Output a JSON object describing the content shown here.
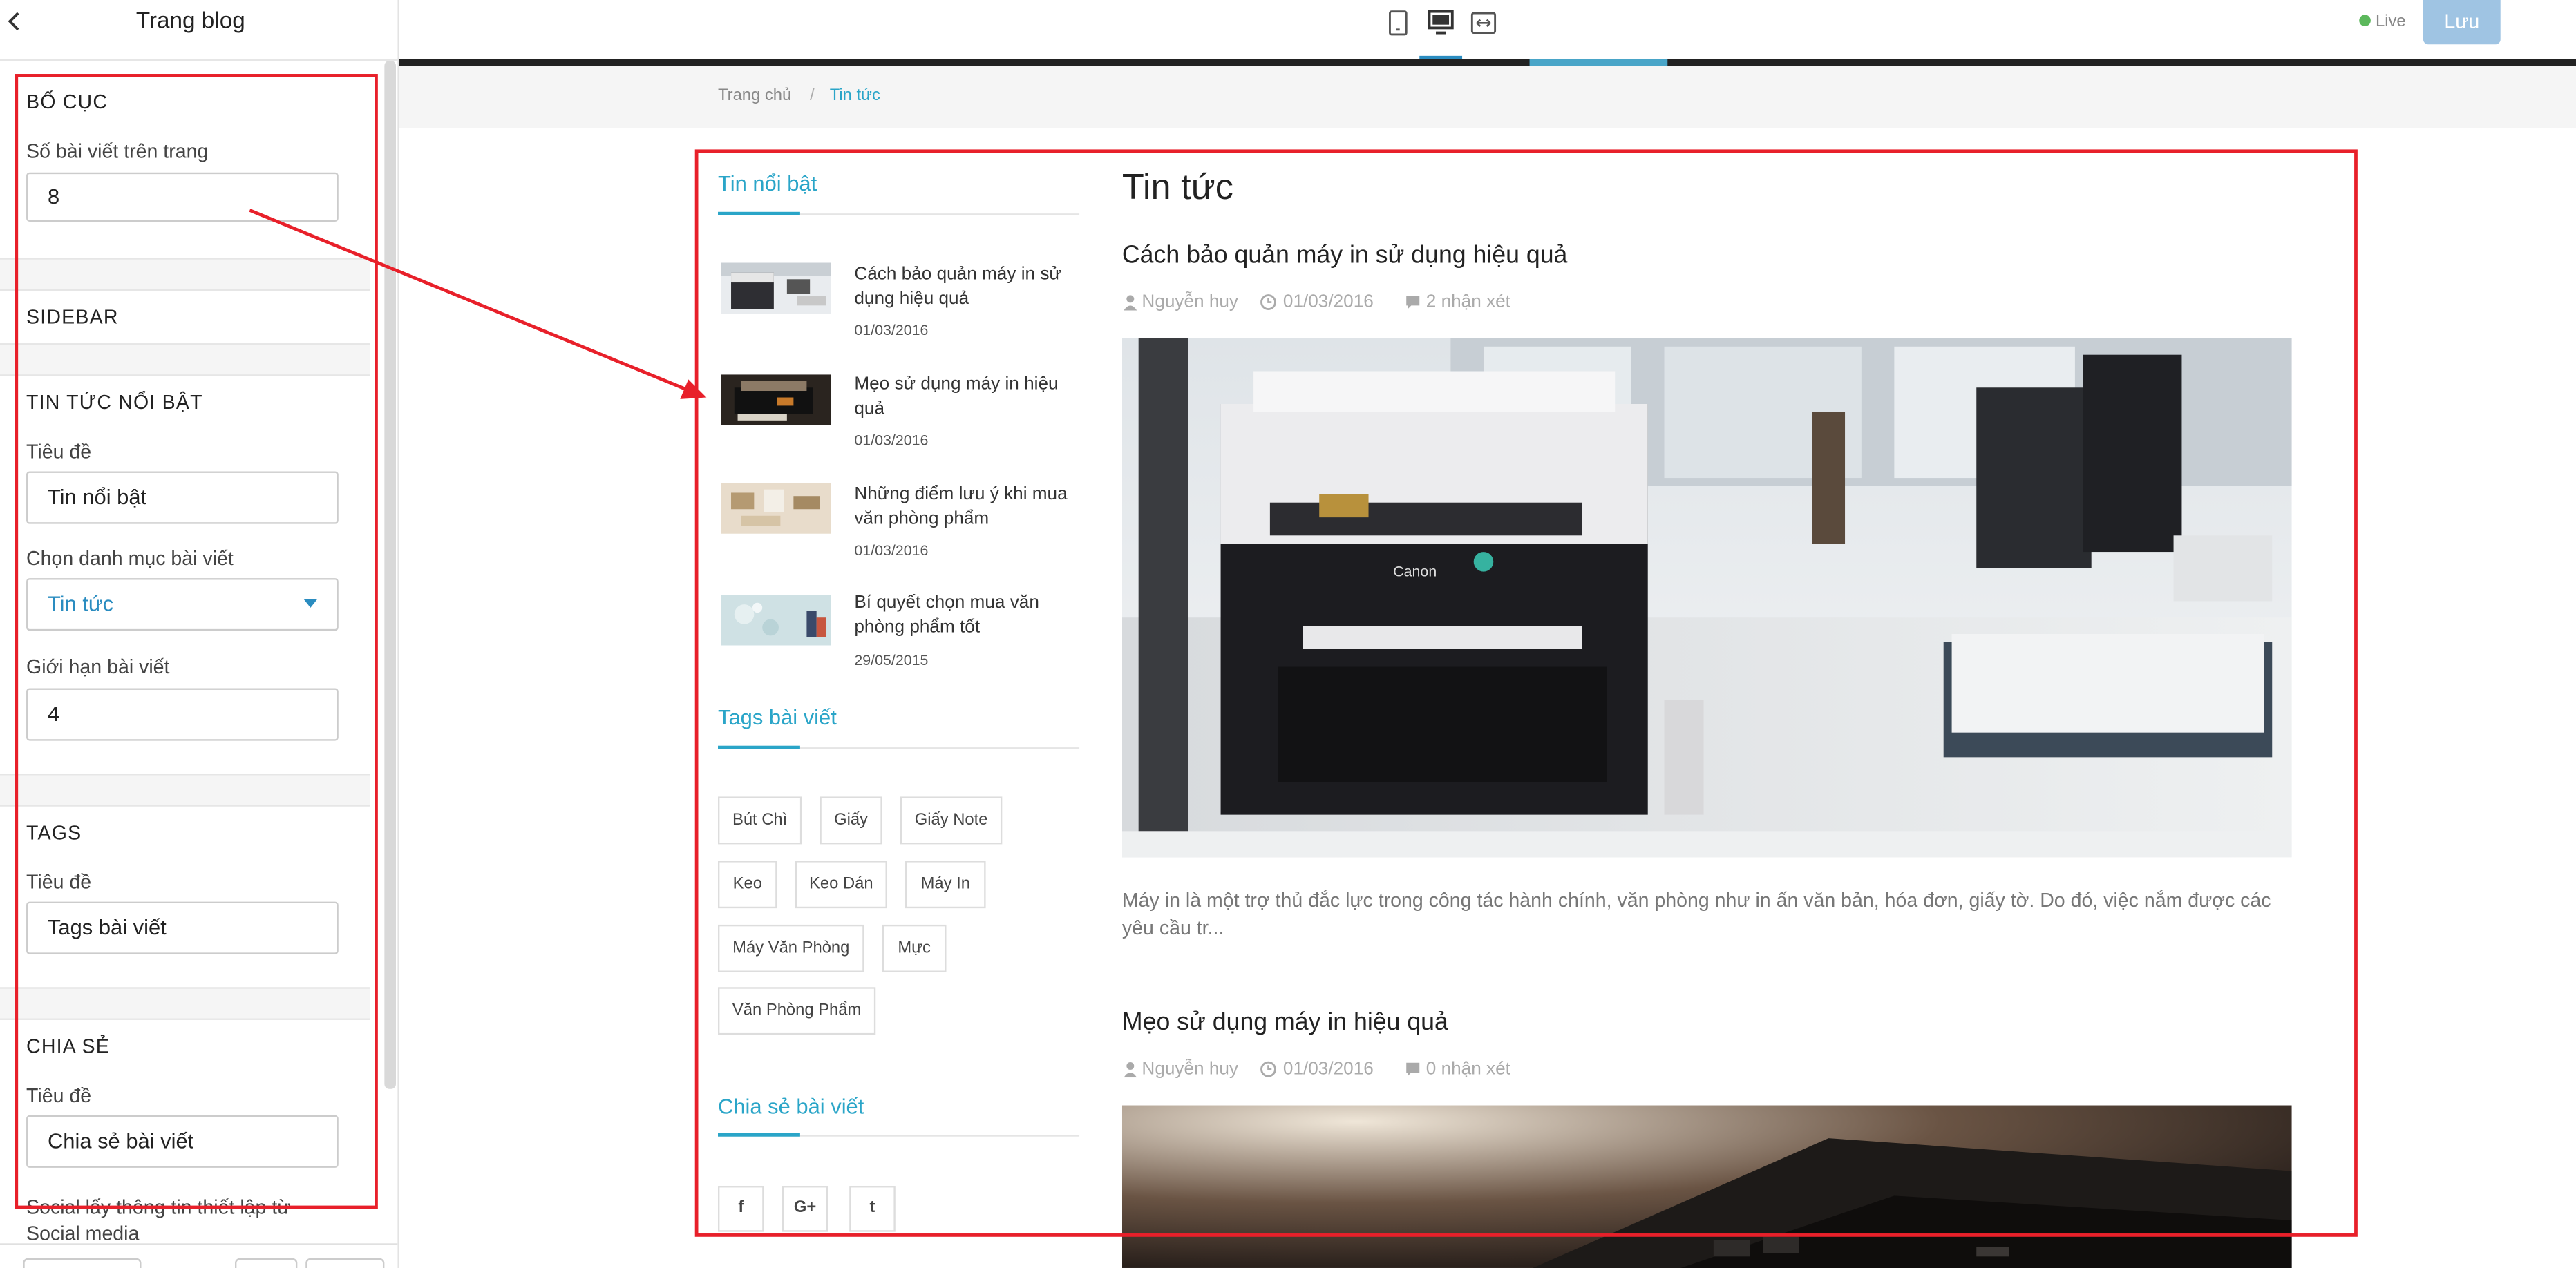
{
  "left_panel": {
    "title": "Trang blog",
    "layout": {
      "section_title": "BỐ CỤC",
      "posts_per_page_label": "Số bài viết trên trang",
      "posts_per_page_value": "8"
    },
    "sidebar": {
      "section_title": "SIDEBAR"
    },
    "featured": {
      "section_title": "TIN TỨC NỔI BẬT",
      "title_label": "Tiêu đề",
      "title_value": "Tin nổi bật",
      "category_label": "Chọn danh mục bài viết",
      "category_value": "Tin tức",
      "limit_label": "Giới hạn bài viết",
      "limit_value": "4"
    },
    "tags": {
      "section_title": "TAGS",
      "title_label": "Tiêu đề",
      "title_value": "Tags bài viết"
    },
    "share": {
      "section_title": "CHIA SẺ",
      "title_label": "Tiêu đề",
      "title_value": "Chia sẻ bài viết",
      "social_note": "Social lấy thông tin thiết lập từ Social media"
    }
  },
  "topbar": {
    "devices": [
      "mobile-icon",
      "desktop-icon",
      "fullwidth-icon"
    ],
    "live_label": "Live",
    "save_label": "Lưu"
  },
  "preview": {
    "breadcrumb": {
      "home": "Trang chủ",
      "separator": "/",
      "current": "Tin tức"
    },
    "sidebar": {
      "featured_title": "Tin nổi bật",
      "featured_posts": [
        {
          "title": "Cách bảo quản máy in sử dụng hiệu quả",
          "date": "01/03/2016"
        },
        {
          "title": "Mẹo sử dụng máy in hiệu quả",
          "date": "01/03/2016"
        },
        {
          "title": "Những điểm lưu ý khi mua văn phòng phẩm",
          "date": "01/03/2016"
        },
        {
          "title": "Bí quyết chọn mua văn phòng phẩm tốt",
          "date": "29/05/2015"
        }
      ],
      "tags_title": "Tags bài viết",
      "tags": [
        "Bút Chì",
        "Giấy",
        "Giấy Note",
        "Keo",
        "Keo Dán",
        "Máy In",
        "Máy Văn Phòng",
        "Mực",
        "Văn Phòng Phẩm"
      ],
      "share_title": "Chia sẻ bài viết",
      "share_buttons": [
        "f",
        "G+",
        "t"
      ]
    },
    "main": {
      "heading": "Tin tức",
      "posts": [
        {
          "title": "Cách bảo quản máy in sử dụng hiệu quả",
          "author": "Nguyễn huy",
          "date": "01/03/2016",
          "comments": "2 nhận xét",
          "excerpt": "Máy in là một trợ thủ đắc lực trong công tác hành chính, văn phòng như in ấn văn bản, hóa đơn, giấy tờ. Do đó, việc nắm được các yêu cầu tr..."
        },
        {
          "title": "Mẹo sử dụng máy in hiệu quả",
          "author": "Nguyễn huy",
          "date": "01/03/2016",
          "comments": "0 nhận xét"
        }
      ],
      "printer_brand": "Canon"
    }
  },
  "colors": {
    "accent": "#2aa5c8",
    "annotation": "#e8202a",
    "save": "#9fc4e3"
  }
}
